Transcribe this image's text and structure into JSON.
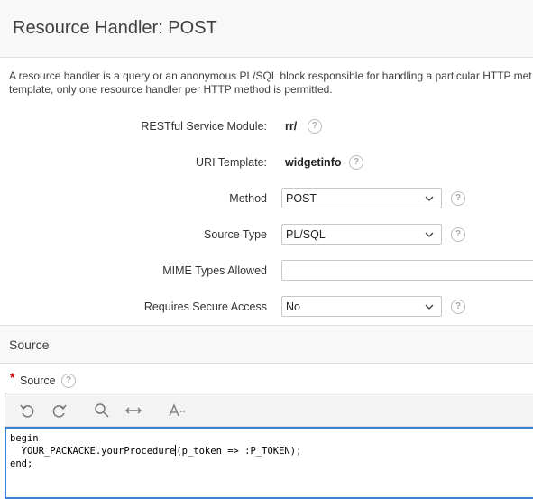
{
  "header": {
    "title": "Resource Handler: POST"
  },
  "description": {
    "line1": "A resource handler is a query or an anonymous PL/SQL block responsible for handling a particular HTTP met",
    "line2": "template, only one resource handler per HTTP method is permitted."
  },
  "form": {
    "module": {
      "label": "RESTful Service Module:",
      "value": "rr/"
    },
    "uri": {
      "label": "URI Template:",
      "value": "widgetinfo"
    },
    "method": {
      "label": "Method",
      "value": "POST"
    },
    "source_type": {
      "label": "Source Type",
      "value": "PL/SQL"
    },
    "mime": {
      "label": "MIME Types Allowed",
      "value": ""
    },
    "secure": {
      "label": "Requires Secure Access",
      "value": "No"
    },
    "help_glyph": "?"
  },
  "source_section": {
    "title": "Source",
    "required_mark": "*",
    "label": "Source"
  },
  "editor": {
    "line1": "begin",
    "line2_before_caret": "  YOUR_PACKACKE.yourProcedure",
    "line2_after_caret": "(p_token => :P_TOKEN);",
    "line3": "end;"
  },
  "colors": {
    "accent": "#3b82d6",
    "required": "#d40000"
  },
  "icons": [
    "undo-icon",
    "redo-icon",
    "search-icon",
    "expand-icon",
    "text-size-icon"
  ]
}
